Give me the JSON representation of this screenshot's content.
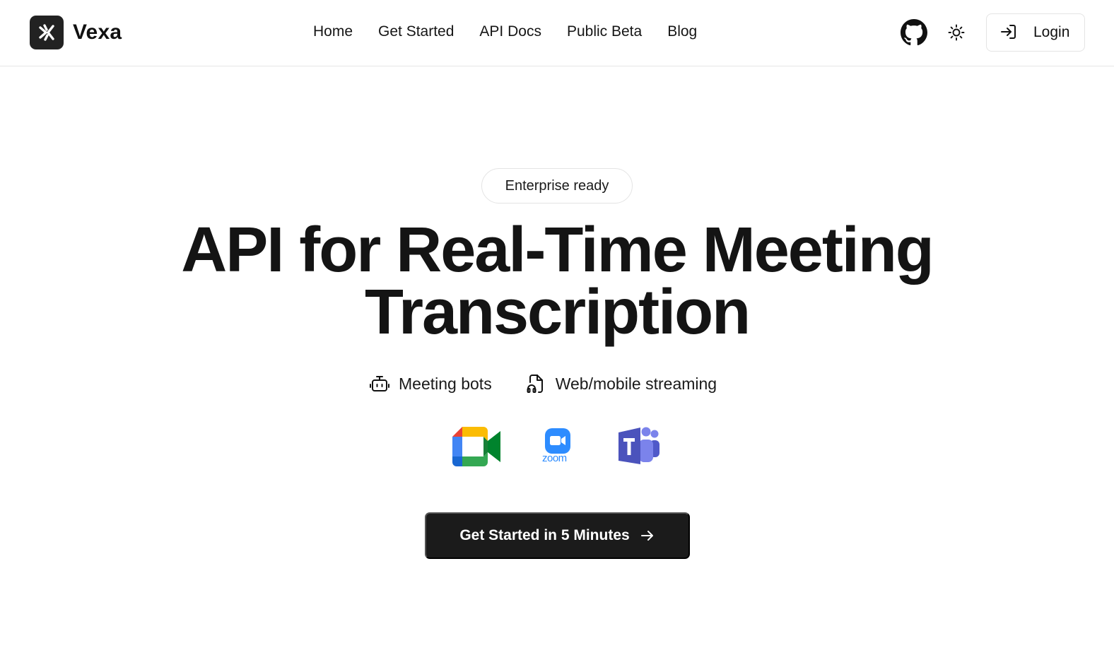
{
  "brand": {
    "name": "Vexa"
  },
  "nav": {
    "items": [
      "Home",
      "Get Started",
      "API Docs",
      "Public Beta",
      "Blog"
    ]
  },
  "header": {
    "login_label": "Login"
  },
  "hero": {
    "badge": "Enterprise ready",
    "title_line1": "API for Real-Time Meeting",
    "title_line2": "Transcription",
    "features": [
      "Meeting bots",
      "Web/mobile streaming"
    ],
    "platforms": [
      "google-meet-logo",
      "zoom-logo",
      "microsoft-teams-logo"
    ],
    "zoom_wordmark": "zoom",
    "cta_label": "Get Started in 5 Minutes"
  },
  "colors": {
    "accent": "#1b1b1b",
    "zoom_blue": "#2d8cff",
    "teams_purple": "#5059c9"
  }
}
